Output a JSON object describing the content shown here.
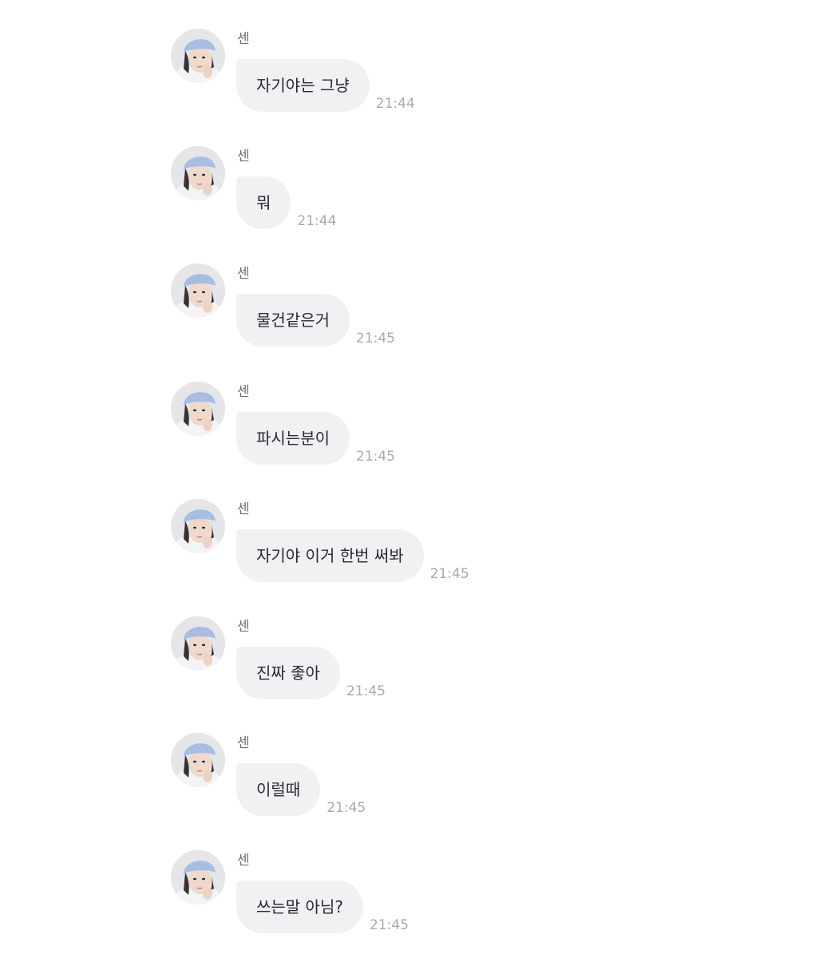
{
  "messages": [
    {
      "sender": "센",
      "text": "자기야는 그냥",
      "time": "21:44"
    },
    {
      "sender": "센",
      "text": "뭐",
      "time": "21:44"
    },
    {
      "sender": "센",
      "text": "물건같은거",
      "time": "21:45"
    },
    {
      "sender": "센",
      "text": "파시는분이",
      "time": "21:45"
    },
    {
      "sender": "센",
      "text": "자기야 이거 한번 써봐",
      "time": "21:45"
    },
    {
      "sender": "센",
      "text": "진짜 좋아",
      "time": "21:45"
    },
    {
      "sender": "센",
      "text": "이럴때",
      "time": "21:45"
    },
    {
      "sender": "센",
      "text": "쓰는말 아님?",
      "time": "21:45"
    }
  ],
  "colors": {
    "bubble_bg": "#f1f1f4",
    "text": "#2a2a2e",
    "sender_text": "#6f6f74",
    "time_text": "#a9a9ae",
    "beanie": "#a9bde3"
  },
  "icons": {
    "avatar": "profile-photo"
  }
}
